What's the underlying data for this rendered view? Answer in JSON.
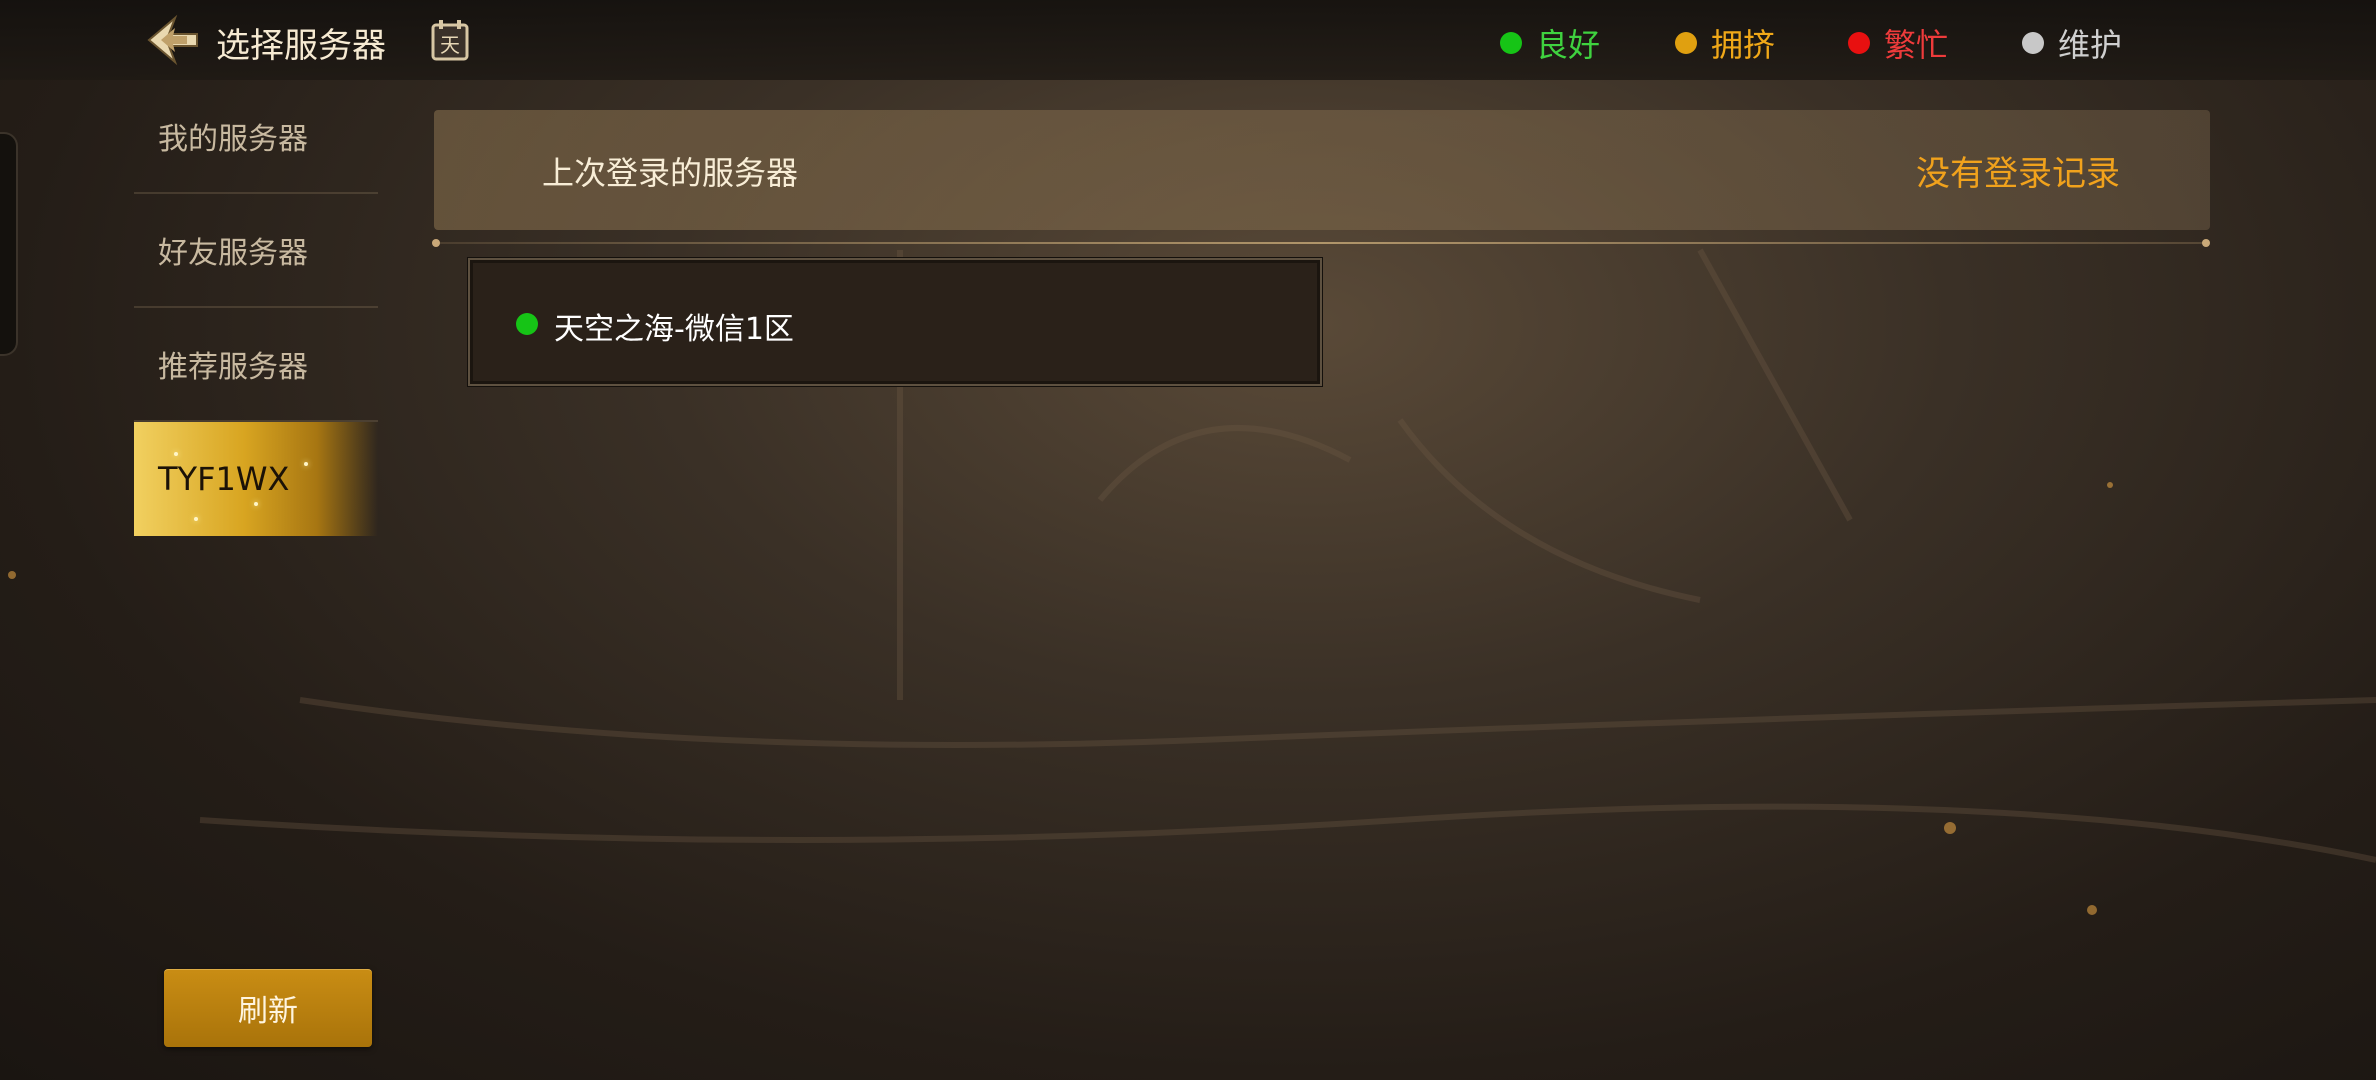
{
  "header": {
    "title": "选择服务器",
    "calendar_icon_char": "天",
    "legend": [
      {
        "label": "良好",
        "color": "#16c416",
        "text_color": "#3fd23f"
      },
      {
        "label": "拥挤",
        "color": "#e0a010",
        "text_color": "#f0a818"
      },
      {
        "label": "繁忙",
        "color": "#e81010",
        "text_color": "#ef3b3b"
      },
      {
        "label": "维护",
        "color": "#c8c8c8",
        "text_color": "#cfcfcf"
      }
    ]
  },
  "sidebar": {
    "items": [
      {
        "label": "我的服务器"
      },
      {
        "label": "好友服务器"
      },
      {
        "label": "推荐服务器"
      },
      {
        "label": "TYF1WX",
        "active": true
      }
    ]
  },
  "last_login": {
    "label": "上次登录的服务器",
    "value": "没有登录记录"
  },
  "servers": [
    {
      "name": "天空之海-微信1区",
      "status_color": "#16c416"
    }
  ],
  "refresh_label": "刷新",
  "colors": {
    "accent_gold": "#c98d14",
    "orange_text": "#f1a21c"
  }
}
